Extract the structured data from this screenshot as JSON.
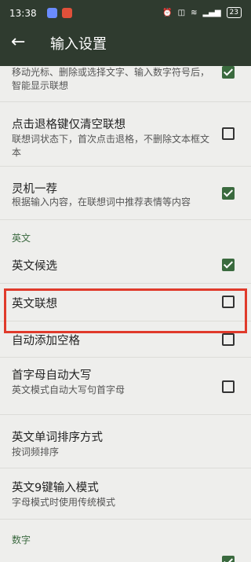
{
  "status": {
    "time": "13:38",
    "battery": "23"
  },
  "header": {
    "title": "输入设置"
  },
  "rows": {
    "top_desc": "移动光标、删除或选择文字、输入数字符号后，智能显示联想",
    "backspace_clear": {
      "label": "点击退格键仅清空联想",
      "desc": "联想词状态下，首次点击退格，不删除文本框文本"
    },
    "lingji": {
      "label": "灵机一荐",
      "desc": "根据输入内容，在联想词中推荐表情等内容"
    },
    "section_english": "英文",
    "english_candidate": {
      "label": "英文候选"
    },
    "english_assoc": {
      "label": "英文联想"
    },
    "auto_space": {
      "label": "自动添加空格"
    },
    "auto_cap": {
      "label": "首字母自动大写",
      "desc": "英文模式自动大写句首字母"
    },
    "word_sort": {
      "label": "英文单词排序方式",
      "desc": "按词频排序"
    },
    "nine_key": {
      "label": "英文9键输入模式",
      "desc": "字母模式时使用传统模式"
    },
    "section_number": "数字"
  },
  "checkbox_states": {
    "top": true,
    "backspace_clear": false,
    "lingji": true,
    "english_candidate": true,
    "english_assoc": false,
    "auto_space": false,
    "auto_cap": false
  },
  "colors": {
    "header": "#2f3b2f",
    "accent": "#3a6a3e",
    "highlight": "#e03a2b"
  }
}
